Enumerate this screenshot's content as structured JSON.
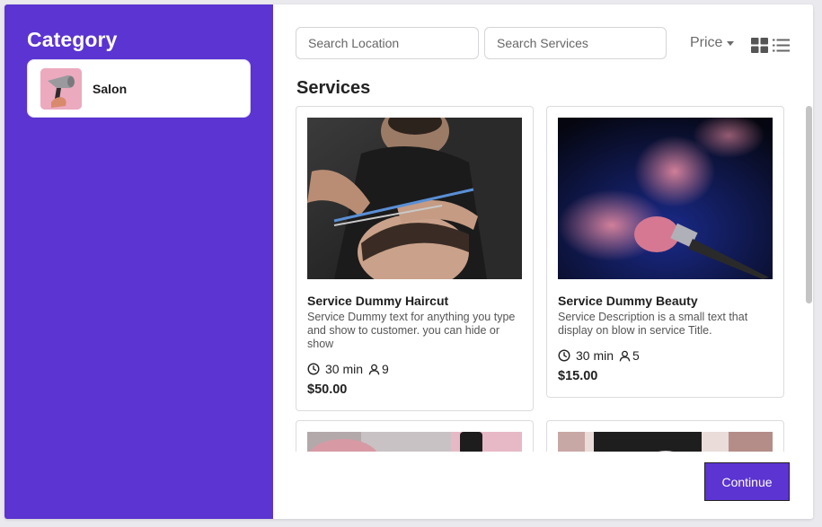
{
  "sidebar": {
    "title": "Category",
    "categories": [
      {
        "label": "Salon",
        "icon": "hair-dryer-icon"
      }
    ]
  },
  "search": {
    "location_placeholder": "Search Location",
    "services_placeholder": "Search Services"
  },
  "toolbar": {
    "price_label": "Price",
    "grid_view_icon": "grid-view-icon",
    "list_view_icon": "list-view-icon"
  },
  "main": {
    "section_title": "Services",
    "services": [
      {
        "title": "Service Dummy Haircut",
        "description": "Service Dummy text for anything you type and show to customer. you can hide or show",
        "duration": "30 min",
        "capacity": "9",
        "price": "$50.00"
      },
      {
        "title": "Service Dummy Beauty",
        "description": "Service Description is a small text that display on blow in service Title.",
        "duration": "30 min",
        "capacity": "5",
        "price": "$15.00"
      }
    ]
  },
  "actions": {
    "continue_label": "Continue"
  },
  "colors": {
    "accent": "#5b34d1",
    "card_border": "#dcdce0"
  }
}
